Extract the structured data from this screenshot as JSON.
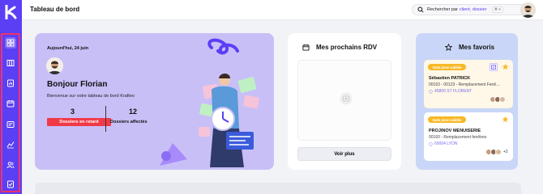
{
  "app": {
    "brand_color": "#5b3ff5",
    "alert_color": "#f03a47",
    "badge_color": "#f7b928"
  },
  "sidebar": {
    "items": [
      {
        "icon": "dashboard-icon",
        "active": true
      },
      {
        "icon": "board-icon"
      },
      {
        "icon": "file-chart-icon"
      },
      {
        "icon": "calendar-icon"
      },
      {
        "icon": "invoice-icon"
      },
      {
        "icon": "analytics-icon"
      },
      {
        "icon": "users-icon"
      },
      {
        "icon": "checklist-icon"
      }
    ]
  },
  "header": {
    "title": "Tableau de bord",
    "search_prefix": "Rechercher par",
    "search_accent": "client, dossier",
    "search_shortcut": "⌘ K"
  },
  "welcome": {
    "date": "Aujourd'hui, 24 juin",
    "greeting": "Bonjour Florian",
    "subtitle": "Bienvenue sur votre tableau de bord Krafteo",
    "late_count": "3",
    "late_label": "Dossiers en retard",
    "assigned_count": "12",
    "assigned_label": "Dossiers affectés"
  },
  "rdv": {
    "title": "Mes prochains RDV",
    "button": "Voir plus"
  },
  "favorites": {
    "title": "Mes favoris",
    "items": [
      {
        "badge": "Date pose validée",
        "name": "Sébastien PATRICK",
        "description": "00163 - 00123 - Remplacement Fenê...",
        "location": "45800 ST FLORENT",
        "more": ""
      },
      {
        "badge": "Date pose validée",
        "name": "PROJINOV MENUISERIE",
        "description": "00160 - Remplacement fenêtres",
        "location": "69004 LYON",
        "more": "+2"
      }
    ]
  }
}
